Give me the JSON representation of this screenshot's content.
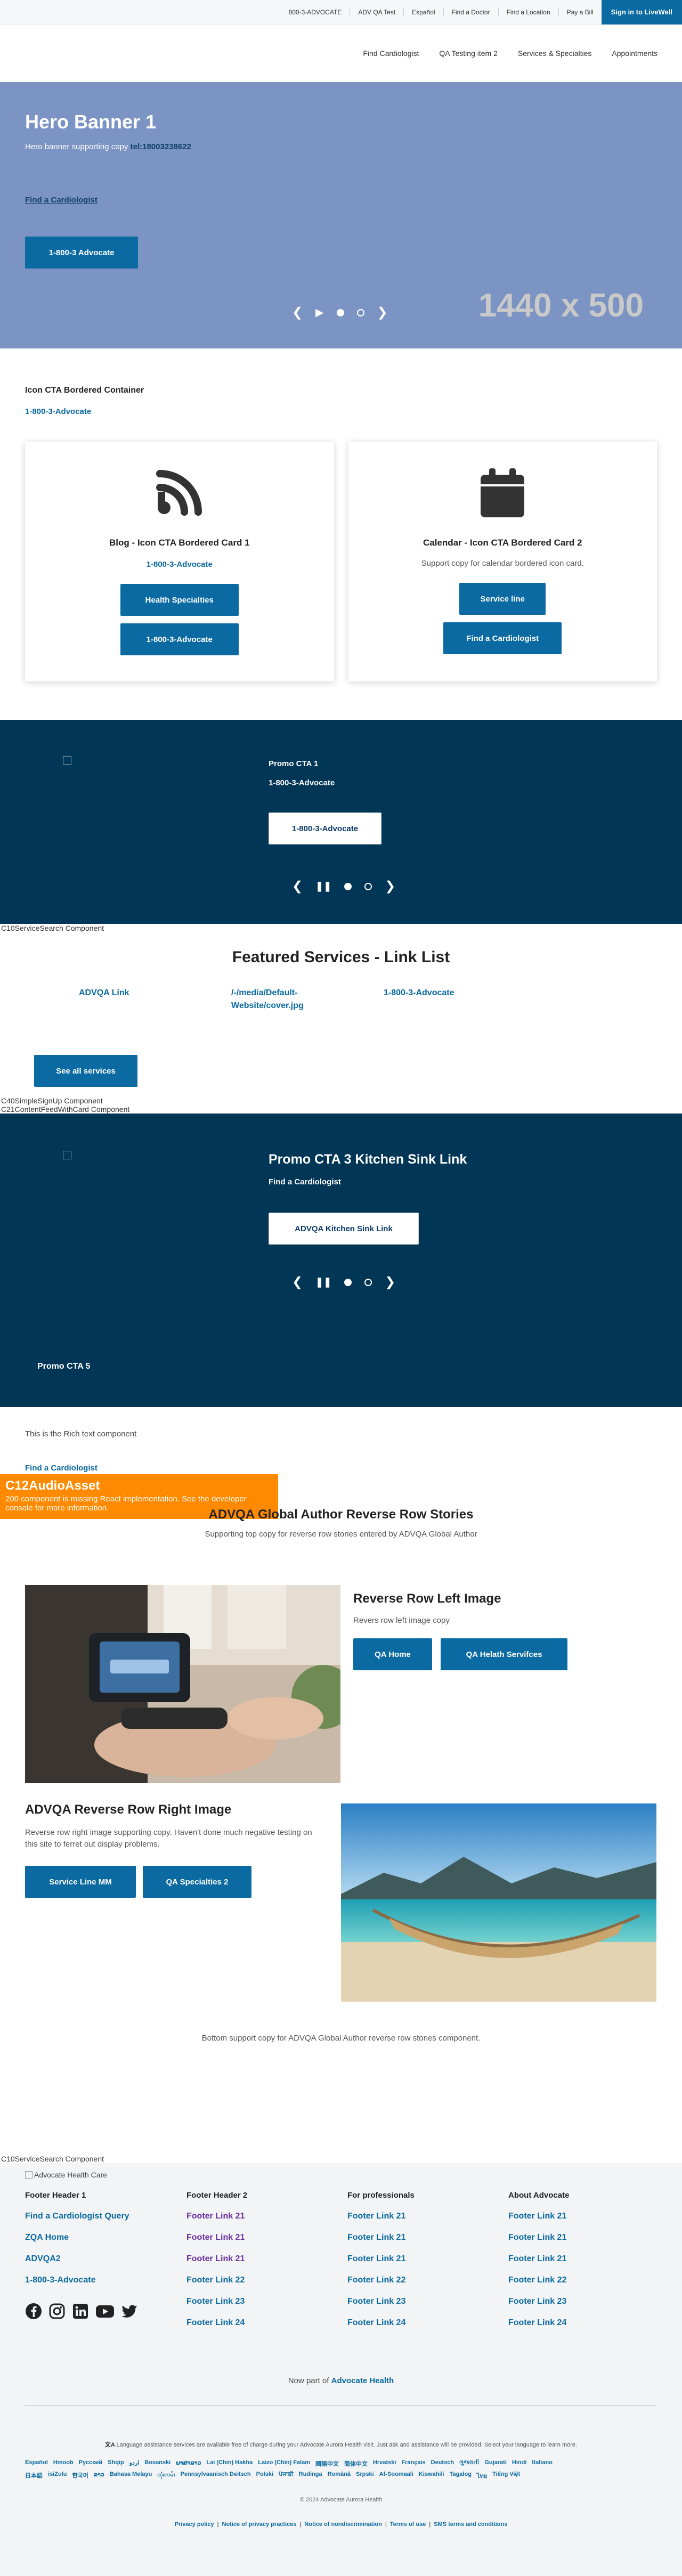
{
  "utility_nav": {
    "links": [
      "800-3-ADVOCATE",
      "ADV QA Test",
      "Español",
      "Find a Doctor",
      "Find a Location",
      "Pay a Bill"
    ],
    "signin": "Sign in to LiveWell"
  },
  "main_nav": [
    "Find Cardiologist",
    "QA Testing item 2",
    "Services & Specialties",
    "Appointments"
  ],
  "hero": {
    "title": "Hero Banner 1",
    "sub_text": "Hero banner supporting copy ",
    "sub_link": "tel:18003238622",
    "find_link": "Find a Cardiologist",
    "button": "1-800-3 Advocate",
    "placeholder": "1440 x 500"
  },
  "icon_cta": {
    "title": "Icon CTA Bordered Container",
    "link": "1-800-3-Advocate",
    "cards": [
      {
        "icon": "rss-icon",
        "title": "Blog - Icon CTA Bordered Card 1",
        "link": "1-800-3-Advocate",
        "support": "",
        "buttons": [
          "Health Specialties",
          "1-800-3-Advocate"
        ]
      },
      {
        "icon": "calendar-icon",
        "title": "Calendar - Icon CTA Bordered Card 2",
        "link": "",
        "support": "Support copy for calendar bordered icon card.",
        "buttons": [
          "Service line",
          "Find a Cardiologist"
        ]
      }
    ]
  },
  "promo1": {
    "title": "Promo CTA 1",
    "link": "1-800-3-Advocate",
    "button": "1-800-3-Advocate"
  },
  "notes": {
    "service_search_1": "C10ServiceSearch Component",
    "signup": "C40SimpleSignUp Component",
    "content_feed": "C21ContentFeedWithCard Component",
    "service_search_2": "C10ServiceSearch Component"
  },
  "featured_services": {
    "title": "Featured Services - Link List",
    "links": [
      "ADVQA Link",
      "/-/media/Default-Website/cover.jpg",
      "1-800-3-Advocate"
    ],
    "button": "See all services"
  },
  "promo3": {
    "title": "Promo CTA 3 Kitchen Sink Link",
    "link": "Find a Cardiologist",
    "button": "ADVQA Kitchen Sink Link",
    "bottom_title": "Promo CTA 5"
  },
  "rich_text": {
    "text": "This is the Rich text component",
    "link": "Find a Cardiologist"
  },
  "audio_warning": {
    "title": "C12AudioAsset",
    "message": "200 component is missing React implementation. See the developer console for more information."
  },
  "reverse_rows": {
    "title": "ADVQA Global Author Reverse Row Stories",
    "support": "Supporting top copy for reverse row stories entered by ADVQA Global Author",
    "row1": {
      "title": "Reverse Row Left Image",
      "copy": "Revers row left image copy",
      "buttons": [
        "QA Home",
        "QA Helath Servifces"
      ]
    },
    "row2": {
      "title": "ADVQA Reverse Row Right Image",
      "copy": "Reverse row right image supporting copy.  Haven't done much negative testing on this site to ferret out display problems.",
      "buttons": [
        "Service Line MM",
        "QA Specialties 2"
      ]
    },
    "bottom": "Bottom support copy for ADVQA Global Author reverse row stories component."
  },
  "footer": {
    "logo_alt": "Advocate Health Care",
    "columns": [
      {
        "header": "Footer Header 1",
        "links": [
          "Find a Cardiologist Query",
          "ZQA Home",
          "ADVQA2",
          "1-800-3-Advocate"
        ]
      },
      {
        "header": "Footer Header 2",
        "links": [
          "Footer Link 21",
          "Footer Link 21",
          "Footer Link 21",
          "Footer Link 22",
          "Footer Link 23",
          "Footer Link 24"
        ]
      },
      {
        "header": "For professionals",
        "links": [
          "Footer Link 21",
          "Footer Link 21",
          "Footer Link 21",
          "Footer Link 22",
          "Footer Link 23",
          "Footer Link 24"
        ]
      },
      {
        "header": "About Advocate",
        "links": [
          "Footer Link 21",
          "Footer Link 21",
          "Footer Link 21",
          "Footer Link 22",
          "Footer Link 23",
          "Footer Link 24"
        ]
      }
    ],
    "now_part": "Now part of ",
    "now_part_link": "Advocate Health",
    "lang_notice": "Language assistance services are available free of charge during your Advocate Aurora Health visit. Just ask and assistance will be provided. Select your language to learn more.",
    "languages_row1": [
      "Español",
      "Hmoob",
      "Русский",
      "Shqip",
      "اردو",
      "Bosanski",
      "ພາສາລາວ",
      "Lai (Chin) Hakha",
      "Laizo (Chin) Falam",
      "國語中文",
      "简体中文",
      "Hrvatski",
      "Français",
      "Deutsch",
      "ગુજરાતી",
      "Gujarati",
      "Hindi",
      "Italiano"
    ],
    "languages_row2": [
      "日本語",
      "isiZulu",
      "한국어",
      "ລາວ",
      "Bahasa Melayu",
      "ထုံးတမ်း",
      "Pennsylvaanisch Deitsch",
      "Polski",
      "ਪੰਜਾਬੀ",
      "Rudinga",
      "Română",
      "Srpski",
      "Af-Soomaali",
      "Kiswahili",
      "Tagalog",
      "ไทย",
      "Tiếng Việt"
    ],
    "copyright": "© 2024 Advocate Aurora Health",
    "legal": [
      "Privacy policy",
      "Notice of privacy practices",
      "Notice of nondiscrimination",
      "Terms of use",
      "SMS terms and conditions"
    ]
  }
}
